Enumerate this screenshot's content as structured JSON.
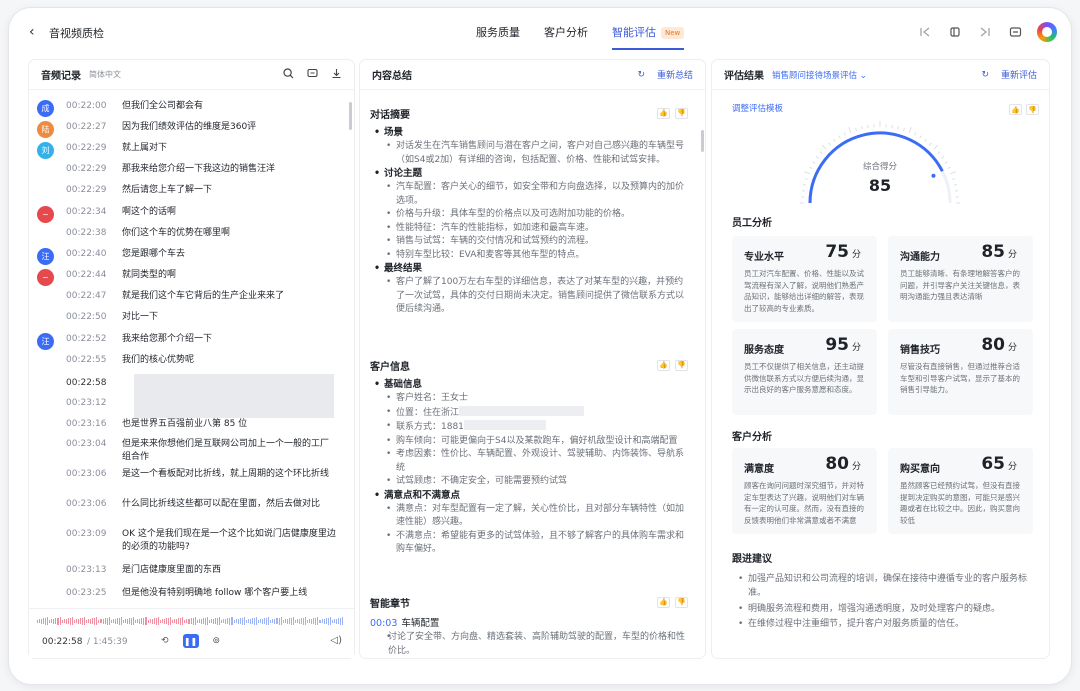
{
  "app": {
    "back_label": "‹",
    "title": "音视频质检"
  },
  "tabs": [
    {
      "label": "服务质量"
    },
    {
      "label": "客户分析"
    },
    {
      "label": "智能评估",
      "badge": "New"
    }
  ],
  "transcript_panel": {
    "title": "音频记录",
    "language": "简体中文",
    "rows": [
      {
        "avatar": "成",
        "color": "#3b6cf6",
        "time": "00:22:00",
        "text": "但我们全公司都会有"
      },
      {
        "avatar": "陆",
        "color": "#f08a3c",
        "time": "00:22:27",
        "text": "因为我们绩效评估的维度是360评"
      },
      {
        "avatar": "刘",
        "color": "#35b0e8",
        "time": "00:22:29",
        "text": "就上属对下"
      },
      {
        "avatar": "",
        "color": "",
        "time": "00:22:29",
        "text": "那我来给您介绍一下我这边的销售汪洋"
      },
      {
        "avatar": "",
        "color": "",
        "time": "00:22:29",
        "text": "然后请您上车了解一下"
      },
      {
        "avatar": "~",
        "color": "#e5484d",
        "time": "00:22:34",
        "text": "啊这个的话啊"
      },
      {
        "avatar": "",
        "color": "",
        "time": "00:22:38",
        "text": "你们这个车的优势在哪里啊"
      },
      {
        "avatar": "汪",
        "color": "#3b6cf6",
        "time": "00:22:40",
        "text": "您是跟哪个车去"
      },
      {
        "avatar": "~",
        "color": "#e5484d",
        "time": "00:22:44",
        "text": "就同类型的啊"
      },
      {
        "avatar": "",
        "color": "",
        "time": "00:22:47",
        "text": "就是我们这个车它背后的生产企业来来了"
      },
      {
        "avatar": "",
        "color": "",
        "time": "00:22:50",
        "text": "对比一下"
      },
      {
        "avatar": "汪",
        "color": "#3b6cf6",
        "time": "00:22:52",
        "text": "我来给您那个介绍一下"
      },
      {
        "avatar": "",
        "color": "",
        "time": "00:22:55",
        "text": "我们的核心优势呢"
      },
      {
        "avatar": "",
        "color": "",
        "time": "00:22:58",
        "text": ""
      },
      {
        "avatar": "",
        "color": "",
        "time": "00:23:12",
        "text": ""
      },
      {
        "avatar": "",
        "color": "",
        "time": "00:23:16",
        "text": "也是世界五百强前业八第 85 位"
      },
      {
        "avatar": "",
        "color": "",
        "time": "00:23:04",
        "text": "但是来来你想他们是互联网公司加上一个一般的工厂组合作"
      },
      {
        "avatar": "",
        "color": "",
        "time": "00:23:06",
        "text": "是这一个看板配对比折线，就上周期的这个环比折线"
      },
      {
        "avatar": "",
        "color": "",
        "time": "00:23:06",
        "text": "什么同比折线这些都可以配在里面，然后去做对比"
      },
      {
        "avatar": "",
        "color": "",
        "time": "00:23:09",
        "text": "OK 这个是我们现在是一个这个比如说门店健康度里边的必须的功能吗?"
      },
      {
        "avatar": "",
        "color": "",
        "time": "00:23:13",
        "text": "是门店健康度里面的东西"
      },
      {
        "avatar": "",
        "color": "",
        "time": "00:23:25",
        "text": "但是他没有特别明确地 follow 哪个客户要上线"
      }
    ],
    "player": {
      "current": "00:22:58",
      "total": "/ 1:45:39"
    }
  },
  "summary_panel": {
    "title": "内容总结",
    "refresh": "重新总结",
    "abstract": {
      "title": "对话摘要",
      "groups": [
        {
          "head": "场景",
          "items": [
            "对话发生在汽车销售顾问与潜在客户之间，客户对自己感兴趣的车辆型号（如S4或2加）有详细的咨询，包括配置、价格、性能和试驾安排。"
          ]
        },
        {
          "head": "讨论主题",
          "items": [
            "汽车配置：客户关心的细节，如安全带和方向盘选择，以及预算内的加价选项。",
            "价格与升级：具体车型的价格点以及可选附加功能的价格。",
            "性能特征：汽车的性能指标，如加速和最高车速。",
            "销售与试驾：车辆的交付情况和试驾预约的流程。",
            "特别车型比较：EVA和麦客等其他车型的特点。"
          ]
        },
        {
          "head": "最终结果",
          "items": [
            "客户了解了100万左右车型的详细信息，表达了对某车型的兴趣，并预约了一次试驾，具体的交付日期尚未决定。销售顾问提供了微信联系方式以便后续沟通。"
          ]
        }
      ]
    },
    "customer": {
      "title": "客户信息",
      "groups": [
        {
          "head": "基础信息",
          "items": [
            "客户姓名：王女士",
            "位置：住在浙江",
            "联系方式：1881",
            "购车倾向：可能更偏向于S4以及某款跑车，偏好机敌型设计和高端配置",
            "考虑因素：性价比、车辆配置、外观设计、驾驶辅助、内饰装饰、导航系统",
            "试驾顾虑：不确定安全，可能需要预约试驾"
          ]
        },
        {
          "head": "满意点和不满意点",
          "items": [
            "满意点：对车型配置有一定了解，关心性价比，且对部分车辆特性（如加速性能）感兴趣。",
            "不满意点：希望能有更多的试驾体验，且不够了解客户的具体购车需求和购车偏好。"
          ]
        }
      ]
    },
    "chapters": {
      "title": "智能章节",
      "items": [
        {
          "time": "00:03",
          "name": "车辆配置",
          "desc": "讨论了安全带、方向盘、精选套装、高阶辅助驾驶的配置，车型的价格和性价比。"
        }
      ]
    }
  },
  "eval_panel": {
    "title": "评估结果",
    "scene": "销售顾问接待场景评估",
    "refresh": "重新评估",
    "template_link": "调整评估模板",
    "gauge": {
      "label": "综合得分",
      "score": 85,
      "max": 100
    },
    "employee": {
      "title": "员工分析",
      "cards": [
        {
          "name": "专业水平",
          "score": "75",
          "unit": "分",
          "desc": "员工对汽车配置、价格、性能以及试驾流程有深入了解，说明他们熟悉产品知识，能够给出详细的解答，表现出了较高的专业素质。"
        },
        {
          "name": "沟通能力",
          "score": "85",
          "unit": "分",
          "desc": "员工能够清晰、有条理地解答客户的问题，并引导客户关注关键信息，表明沟通能力强且表达清晰"
        },
        {
          "name": "服务态度",
          "score": "95",
          "unit": "分",
          "desc": "员工不仅提供了相关信息，还主动提供微信联系方式以方便后续沟通，显示出良好的客户服务意愿和态度。"
        },
        {
          "name": "销售技巧",
          "score": "80",
          "unit": "分",
          "desc": "尽管没有直接销售，但通过推荐合适车型和引导客户试驾，显示了基本的销售引导能力。"
        }
      ]
    },
    "customer": {
      "title": "客户分析",
      "cards": [
        {
          "name": "满意度",
          "score": "80",
          "unit": "分",
          "desc": "顾客在询问问题时深究细节，并对特定车型表达了兴趣，说明他们对车辆有一定的认可度。然而，没有直接的反馈表明他们非常满意或者不满意"
        },
        {
          "name": "购买意向",
          "score": "65",
          "unit": "分",
          "desc": "虽然顾客已经预约试驾，但没有直接提到决定购买的意图，可能只是感兴趣或者在比较之中。因此，购买意向较低"
        }
      ]
    },
    "advice": {
      "title": "跟进建议",
      "items": [
        "加强产品知识和公司流程的培训，确保在接待中遵循专业的客户服务标准。",
        "明确服务流程和费用，增强沟通透明度，及时处理客户的疑虑。",
        "在维修过程中注重细节，提升客户对服务质量的信任。"
      ]
    },
    "accent": "#3b6cf6"
  }
}
